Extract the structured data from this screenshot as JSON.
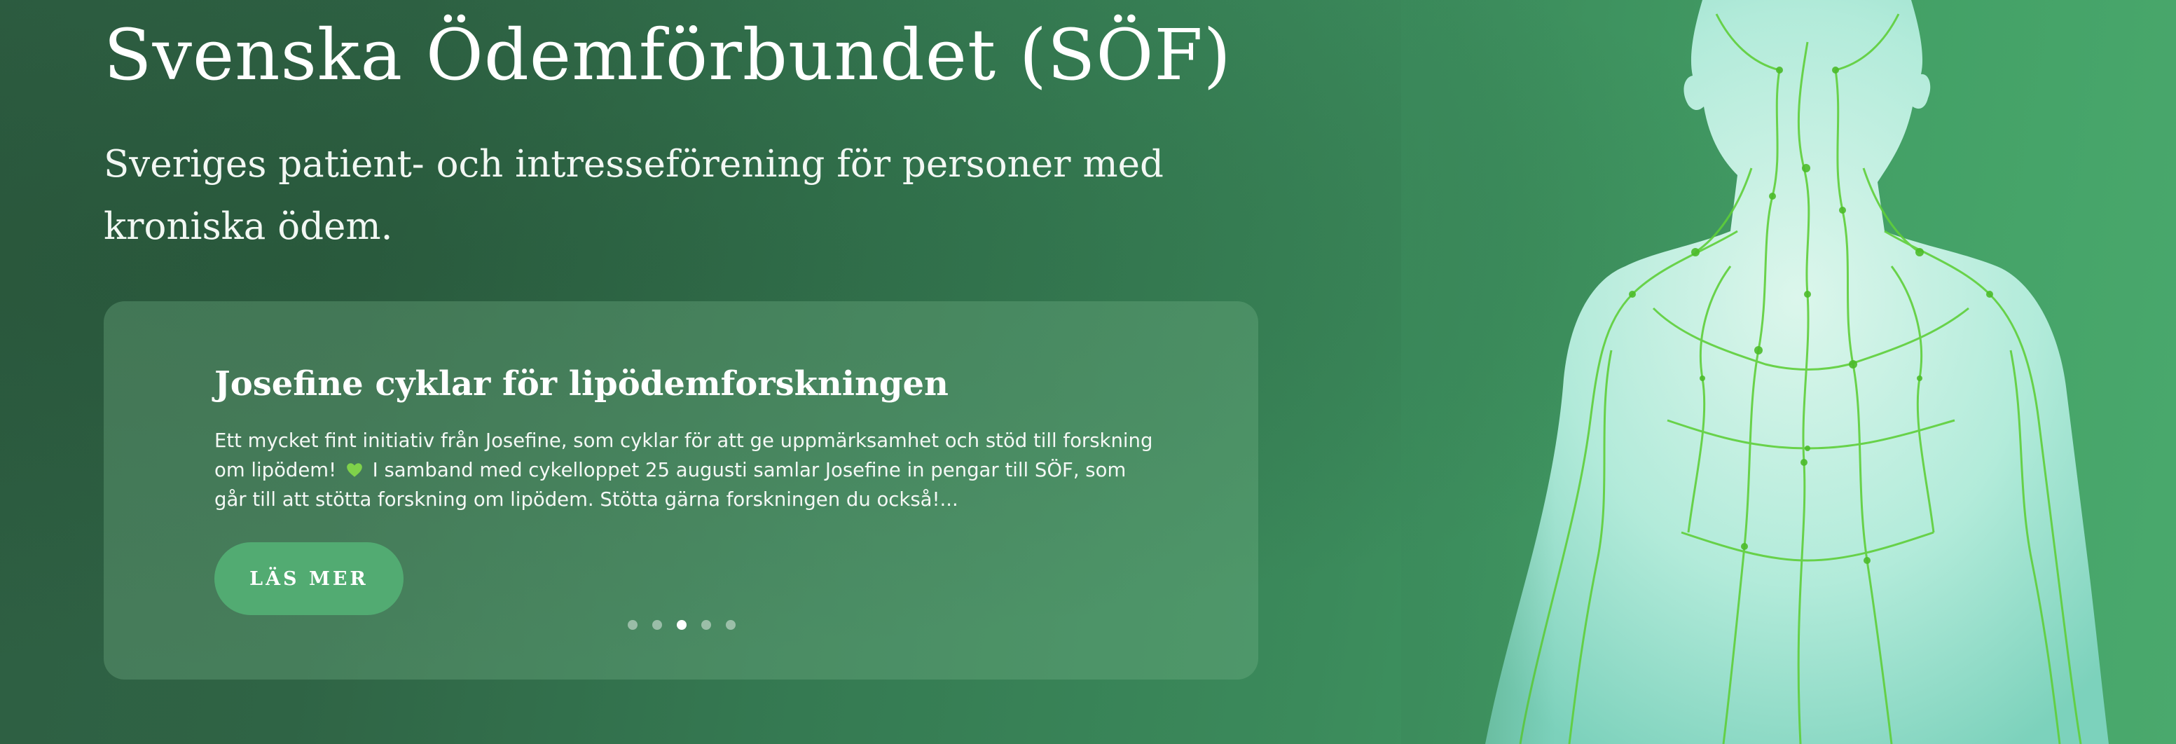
{
  "hero": {
    "title": "Svenska Ödemförbundet (SÖF)",
    "subtitle": "Sveriges patient- och intresseförening för personer med kroniska ödem."
  },
  "news": {
    "title": "Josefine cyklar för lipödemforskningen",
    "excerpt_part1": "Ett mycket fint initiativ från Josefine, som cyklar för att ge uppmärksamhet och stöd till forskning om lipödem!",
    "excerpt_part2": "I samband med cykelloppet 25 augusti samlar Josefine in pengar till SÖF, som går till att stötta forskning om lipödem. Stötta gärna forskningen du också!...",
    "heart_icon": "green-heart-icon",
    "read_more_label": "LÄS MER"
  },
  "carousel": {
    "slide_count": 5,
    "active_index": 2
  },
  "image": {
    "icon": "lymphatic-system-figure"
  },
  "colors": {
    "accent_green": "#52ab72",
    "background_dark": "#2e5e42",
    "background_light": "#4aa96d",
    "lymph_green": "#5fcf3a"
  }
}
